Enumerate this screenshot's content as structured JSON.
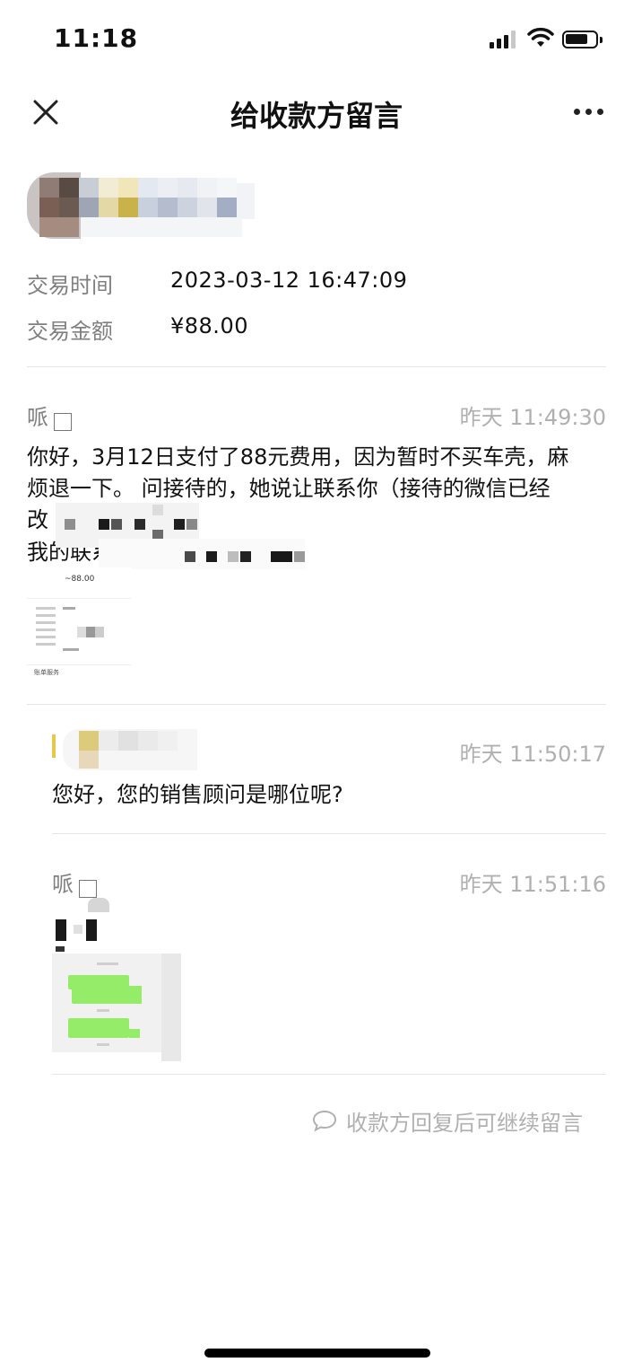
{
  "status_bar": {
    "time": "11:18"
  },
  "nav": {
    "title": "给收款方留言"
  },
  "transaction": {
    "time_label": "交易时间",
    "time_value": "2023-03-12 16:47:09",
    "amount_label": "交易金额",
    "amount_value": "¥88.00"
  },
  "messages": [
    {
      "sender": "哌",
      "timestamp": "昨天 11:49:30",
      "line1": "你好，3月12日支付了88元费用，因为暂时不买车壳，麻",
      "line2": "烦退一下。 问接待的，她说让联系你（接待的微信已经",
      "line3": "改",
      "line4": "我的联系方式",
      "thumb_amount": "~88.00",
      "thumb_footer": "账单服务"
    },
    {
      "timestamp": "昨天 11:50:17",
      "text": "您好，您的销售顾问是哪位呢?"
    },
    {
      "sender": "哌",
      "timestamp": "昨天 11:51:16"
    }
  ],
  "footer_note": "收款方回复后可继续留言",
  "colors": {
    "accent_bar": "#e8c84a",
    "chat_green": "#95ec69",
    "muted": "#b0b0b0"
  }
}
